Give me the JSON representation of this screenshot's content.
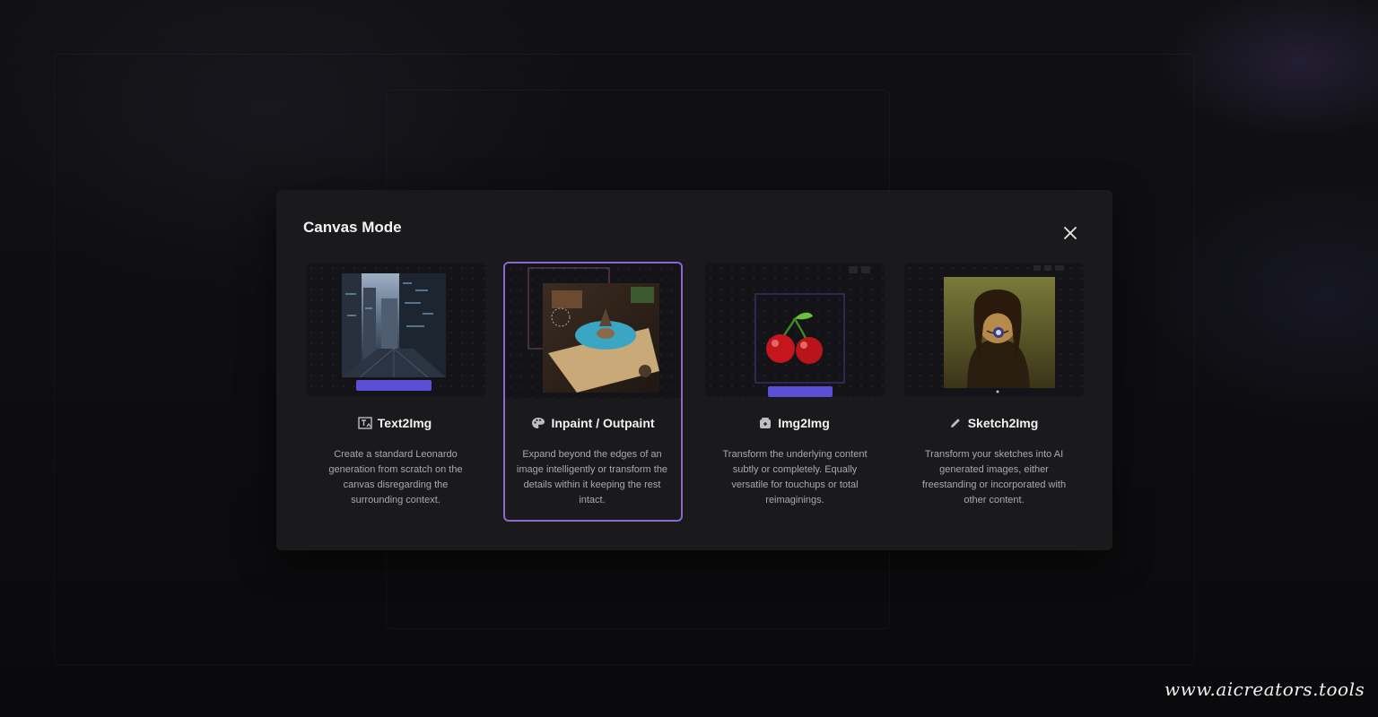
{
  "modal": {
    "title": "Canvas Mode"
  },
  "cards": [
    {
      "label": "Text2Img",
      "icon": "text-image-icon",
      "description": "Create a standard Leonardo generation from scratch on the canvas disregarding the surrounding context.",
      "selected": false
    },
    {
      "label": "Inpaint / Outpaint",
      "icon": "palette-icon",
      "description": "Expand beyond the edges of an image intelligently or transform the details within it keeping the rest intact.",
      "selected": true
    },
    {
      "label": "Img2Img",
      "icon": "image-transform-icon",
      "description": "Transform the underlying content subtly or completely. Equally versatile for touchups or total reimaginings.",
      "selected": false
    },
    {
      "label": "Sketch2Img",
      "icon": "pencil-icon",
      "description": "Transform your sketches into AI generated images, either freestanding or incorporated with other content.",
      "selected": false
    }
  ],
  "watermark": "www.aicreators.tools",
  "colors": {
    "accent": "#8a68d4",
    "modal_bg": "#1a1a1c",
    "toolbar": "#5b4fd8"
  }
}
